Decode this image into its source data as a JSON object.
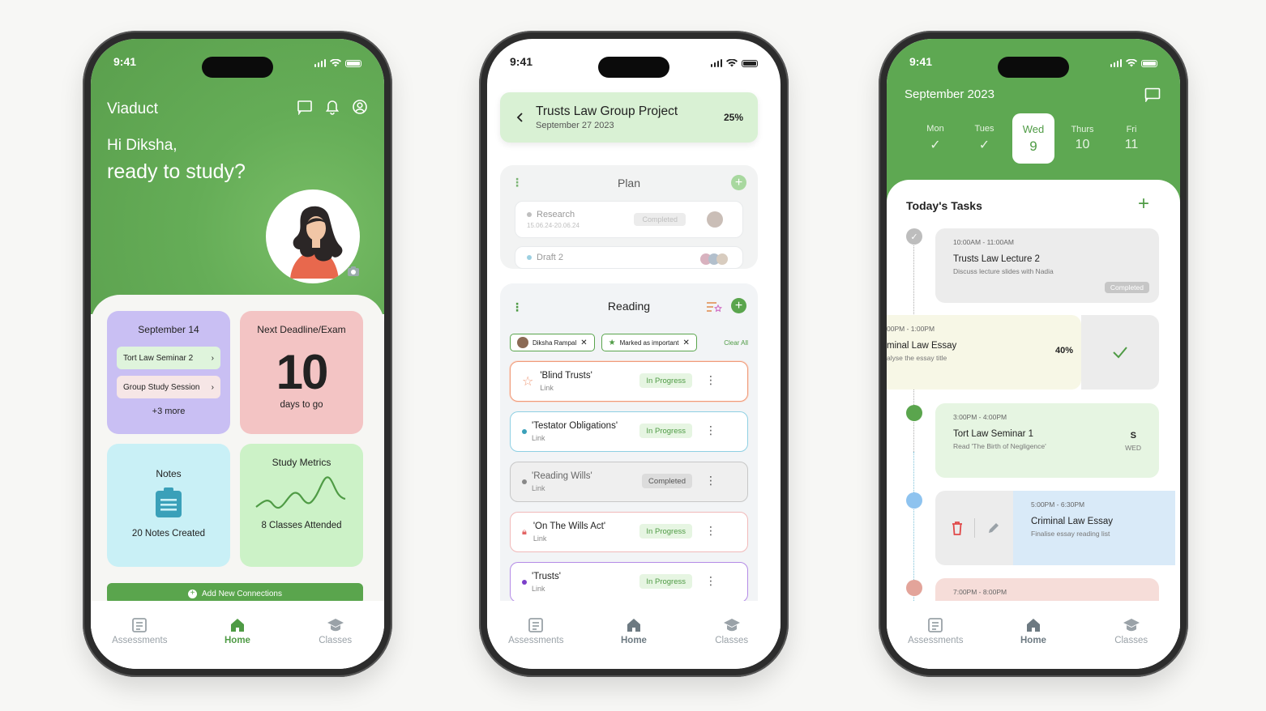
{
  "status_time": "9:41",
  "tabs": [
    "Assessments",
    "Home",
    "Classes"
  ],
  "home": {
    "brand": "Viaduct",
    "greeting_line1": "Hi Diksha,",
    "greeting_line2": "ready to study?",
    "calendar_card": {
      "title": "September 14",
      "items": [
        "Tort Law Seminar 2",
        "Group Study Session"
      ],
      "more": "+3 more"
    },
    "deadline_card": {
      "title": "Next Deadline/Exam",
      "value": "10",
      "unit": "days to go"
    },
    "notes_card": {
      "title": "Notes",
      "count": "20 Notes Created"
    },
    "metrics_card": {
      "title": "Study Metrics",
      "count": "8 Classes Attended"
    },
    "add_button": "Add New Connections"
  },
  "project": {
    "title": "Trusts Law Group Project",
    "date": "September 27 2023",
    "progress": "25%",
    "plan": {
      "title": "Plan",
      "items": [
        {
          "name": "Research",
          "dates": "15.06.24-20.06.24",
          "status": "Completed"
        },
        {
          "name": "Draft 2"
        }
      ]
    },
    "reading": {
      "title": "Reading",
      "filters": [
        "Diksha Rampal",
        "Marked as important"
      ],
      "clear": "Clear All",
      "items": [
        {
          "title": "'Blind Trusts'",
          "link": "Link",
          "status": "In Progress"
        },
        {
          "title": "'Testator Obligations'",
          "link": "Link",
          "status": "In Progress"
        },
        {
          "title": "'Reading Wills'",
          "link": "Link",
          "status": "Completed"
        },
        {
          "title": "'On The Wills Act'",
          "link": "Link",
          "status": "In Progress"
        },
        {
          "title": "'Trusts'",
          "link": "Link",
          "status": "In Progress"
        }
      ]
    }
  },
  "schedule": {
    "month": "September 2023",
    "days": [
      {
        "name": "Mon",
        "num": ""
      },
      {
        "name": "Tues",
        "num": ""
      },
      {
        "name": "Wed",
        "num": "9"
      },
      {
        "name": "Thurs",
        "num": "10"
      },
      {
        "name": "Fri",
        "num": "11"
      }
    ],
    "title": "Today's Tasks",
    "tasks": [
      {
        "time": "10:00AM - 11:00AM",
        "name": "Trusts Law Lecture 2",
        "desc": "Discuss lecture slides with Nadia",
        "badge": "Completed"
      },
      {
        "time": "00PM - 1:00PM",
        "name": "minal Law Essay",
        "desc": "alyse the essay title",
        "pct": "40%"
      },
      {
        "time": "3:00PM - 4:00PM",
        "name": "Tort Law Seminar 1",
        "desc": "Read 'The Birth of Negligence'",
        "side_top": "S",
        "side_bottom": "WED"
      },
      {
        "time": "5:00PM - 6:30PM",
        "name": "Criminal Law Essay",
        "desc": "Finalise essay reading list"
      },
      {
        "time": "7:00PM - 8:00PM"
      }
    ]
  }
}
